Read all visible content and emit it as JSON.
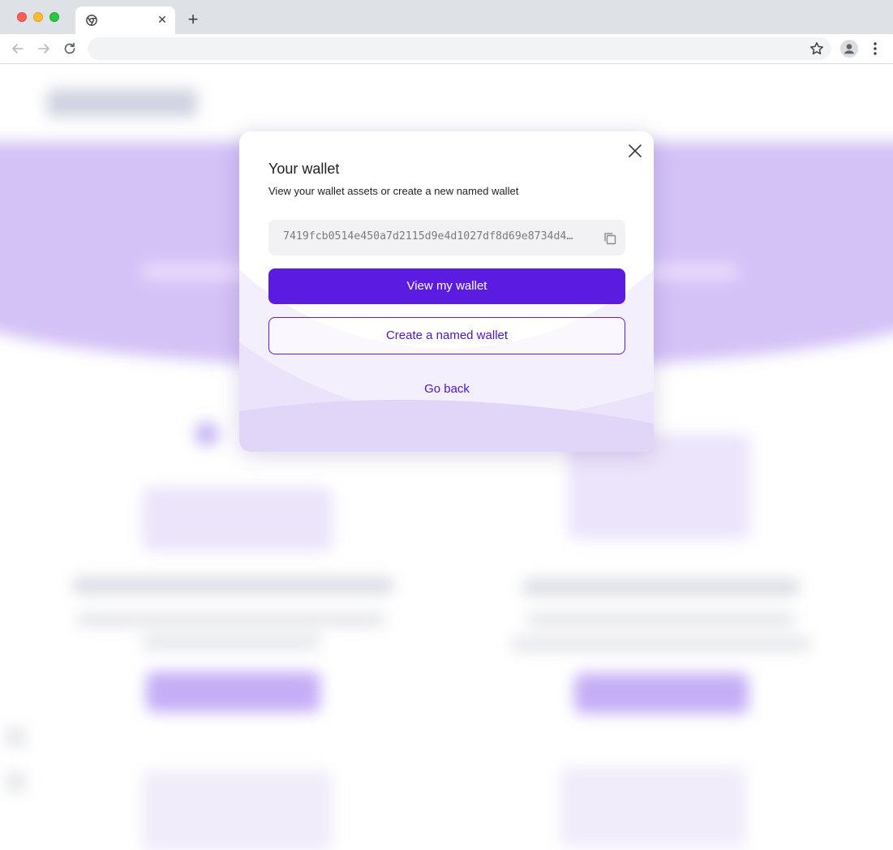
{
  "browser": {
    "tab_title": "",
    "tab_close_glyph": "✕",
    "new_tab_glyph": "+",
    "address_bar": ""
  },
  "modal": {
    "title": "Your wallet",
    "subtitle": "View your wallet assets or create a new named wallet",
    "address": "7419fcb0514e450a7d2115d9e4d1027df8d69e8734d4…",
    "primary_button": "View my wallet",
    "secondary_button": "Create a named wallet",
    "back_link": "Go back"
  },
  "colors": {
    "accent": "#5b1be0",
    "accent_text": "#4d14c9",
    "band": "#d3c2f6"
  },
  "icons": [
    "chrome-icon",
    "back-arrow-icon",
    "forward-arrow-icon",
    "reload-icon",
    "bookmark-star-icon",
    "profile-icon",
    "more-menu-icon",
    "close-icon",
    "copy-icon"
  ]
}
